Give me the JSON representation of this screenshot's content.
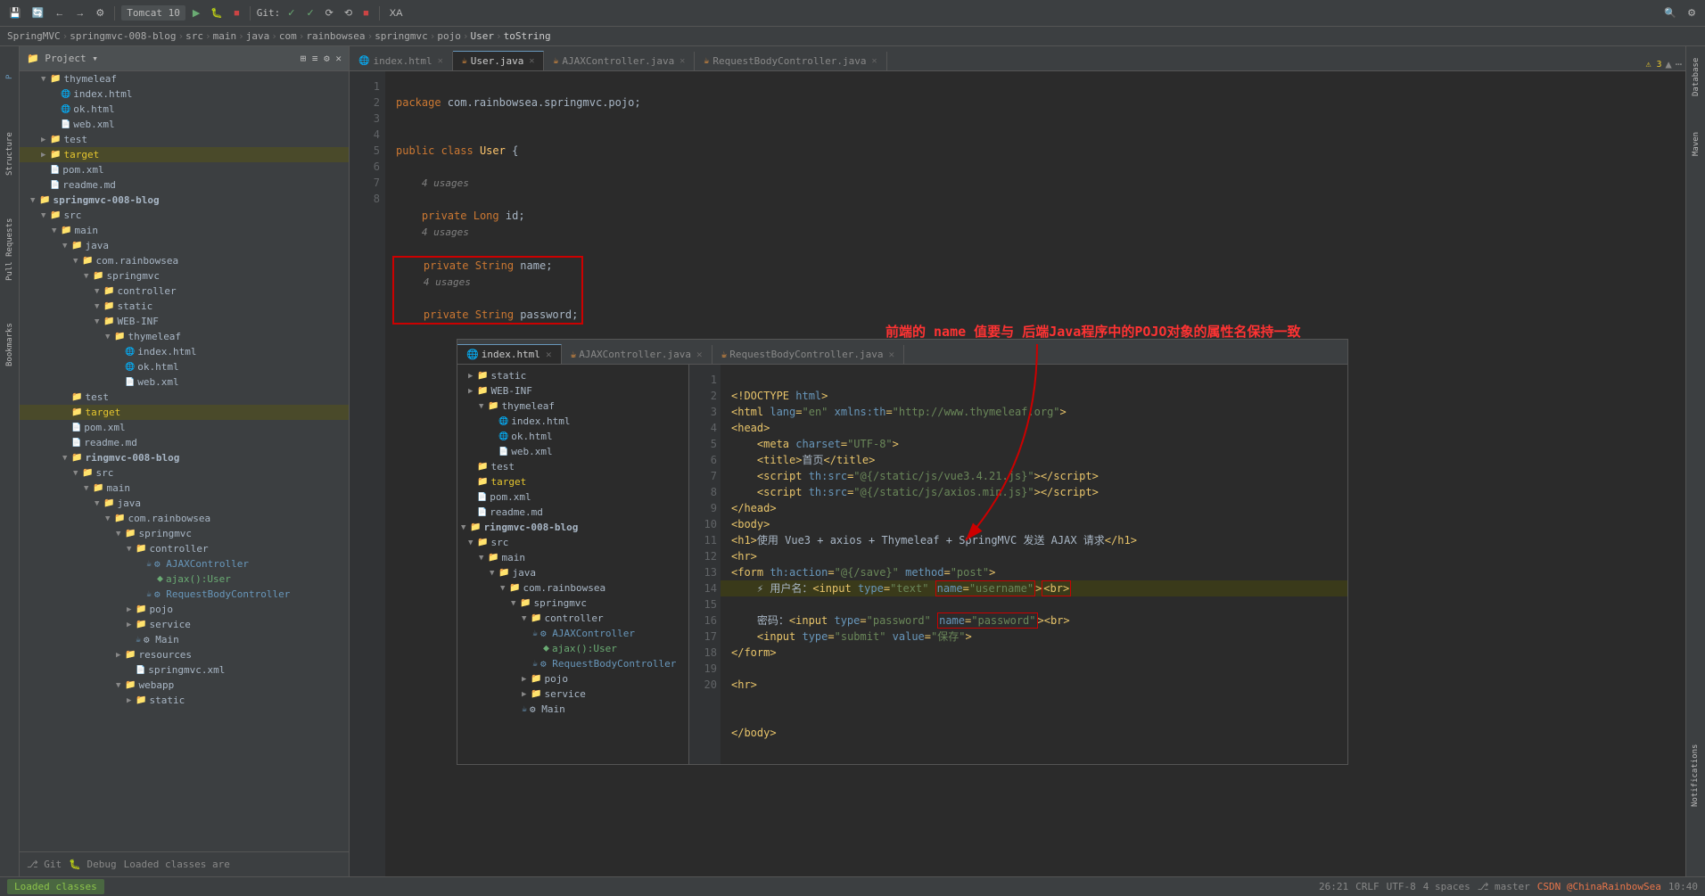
{
  "toolbar": {
    "tomcat_label": "Tomcat 10",
    "git_label": "Git:"
  },
  "breadcrumb": {
    "items": [
      "SpringMVC",
      "springmvc-008-blog",
      "src",
      "main",
      "java",
      "com",
      "rainbowsea",
      "springmvc",
      "pojo",
      "User",
      "toString"
    ]
  },
  "tabs": [
    {
      "label": "index.html",
      "icon": "html",
      "active": false
    },
    {
      "label": "User.java",
      "icon": "java",
      "active": true
    },
    {
      "label": "AJAXController.java",
      "icon": "java",
      "active": false
    },
    {
      "label": "RequestBodyController.java",
      "icon": "java",
      "active": false
    }
  ],
  "overlay_tabs": [
    {
      "label": "index.html",
      "active": true
    },
    {
      "label": "AJAXController.java",
      "active": false
    },
    {
      "label": "RequestBodyController.java",
      "active": false
    }
  ],
  "project_tree": {
    "title": "Project"
  },
  "annotation": {
    "text": "前端的 name 值要与 后端Java程序中的POJO对象的属性名保持一致"
  },
  "status": {
    "loaded_classes": "Loaded classes",
    "position": "26:21",
    "line_sep": "CRLF",
    "encoding": "UTF-8",
    "indent": "4 spaces",
    "vcs": "master"
  },
  "bottom_bar": {
    "git_label": "Git",
    "debug_label": "Debug",
    "loaded_label": "Loaded classes are"
  }
}
